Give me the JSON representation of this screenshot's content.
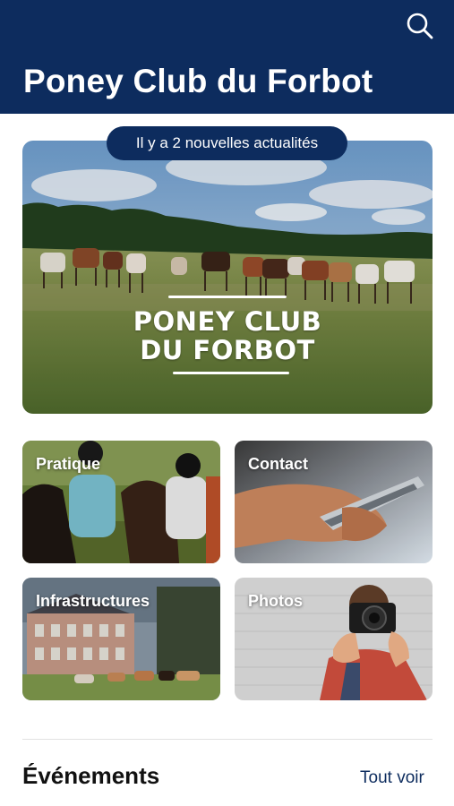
{
  "header": {
    "title": "Poney Club du Forbot",
    "search_icon": "search-icon",
    "background": "#0d2c5e"
  },
  "news_banner": {
    "text": "Il y a 2 nouvelles actualités"
  },
  "hero": {
    "logo_line1": "PONEY CLUB",
    "logo_line2": "DU FORBOT"
  },
  "tiles": [
    {
      "label": "Pratique"
    },
    {
      "label": "Contact"
    },
    {
      "label": "Infrastructures"
    },
    {
      "label": "Photos"
    }
  ],
  "events": {
    "title": "Événements",
    "see_all": "Tout voir"
  }
}
